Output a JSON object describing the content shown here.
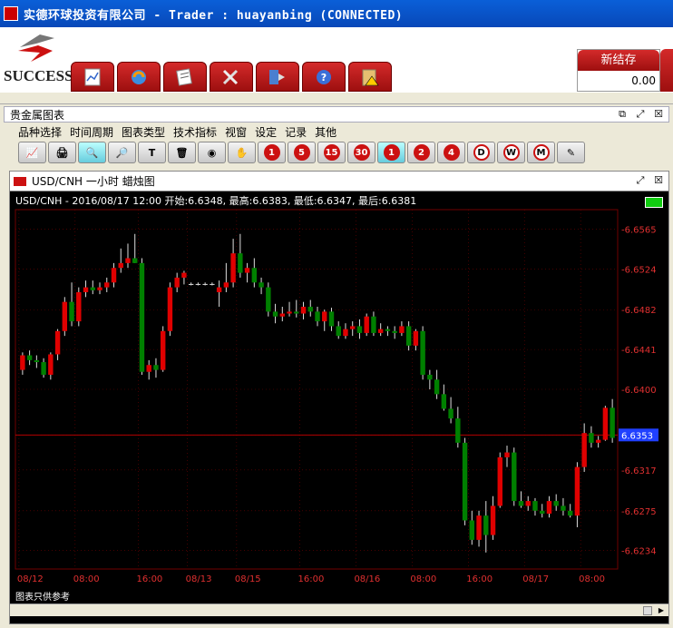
{
  "window": {
    "title": "实德环球投资有限公司 -  Trader : huayanbing (CONNECTED)"
  },
  "brand": {
    "logo_text": "SUCCESS"
  },
  "toolbar": {
    "buttons": [
      {
        "icon": "chart-doc-icon"
      },
      {
        "icon": "refresh-icon"
      },
      {
        "icon": "notes-icon"
      },
      {
        "icon": "tools-icon"
      },
      {
        "icon": "export-icon"
      },
      {
        "icon": "help-icon"
      },
      {
        "icon": "alert-clipboard-icon"
      }
    ]
  },
  "balance": {
    "label": "新结存",
    "value": "0.00"
  },
  "panel": {
    "title": "贵金属图表",
    "menu": [
      "品种选择",
      "时间周期",
      "图表类型",
      "技术指标",
      "视窗",
      "设定",
      "记录",
      "其他"
    ],
    "icon_buttons": [
      {
        "label": "",
        "name": "line-chart-icon"
      },
      {
        "label": "",
        "name": "print-icon"
      },
      {
        "label": "",
        "name": "zoom-in-icon",
        "selected": true
      },
      {
        "label": "",
        "name": "zoom-out-icon"
      },
      {
        "label": "T",
        "name": "text-tool-icon"
      },
      {
        "label": "",
        "name": "delete-icon"
      },
      {
        "label": "",
        "name": "record-icon"
      },
      {
        "label": "",
        "name": "hand-icon"
      },
      {
        "label": "1",
        "name": "period-1m-icon"
      },
      {
        "label": "5",
        "name": "period-5m-icon"
      },
      {
        "label": "15",
        "name": "period-15m-icon"
      },
      {
        "label": "30",
        "name": "period-30m-icon"
      },
      {
        "label": "1",
        "name": "period-1h-icon",
        "selected": true
      },
      {
        "label": "2",
        "name": "period-2h-icon"
      },
      {
        "label": "4",
        "name": "period-4h-icon"
      },
      {
        "label": "D",
        "name": "period-day-icon"
      },
      {
        "label": "W",
        "name": "period-week-icon"
      },
      {
        "label": "M",
        "name": "period-month-icon"
      },
      {
        "label": "",
        "name": "pen-icon"
      }
    ]
  },
  "chart_window": {
    "title": "USD/CNH 一小时 蜡烛图",
    "info": "USD/CNH - 2016/08/17 12:00 开始:6.6348, 最高:6.6383, 最低:6.6347, 最后:6.6381",
    "footnote": "图表只供参考"
  },
  "chart_data": {
    "type": "candlestick",
    "ylim": [
      6.6215,
      6.6585
    ],
    "y_ticks": [
      "6.6565",
      "6.6524",
      "6.6482",
      "6.6441",
      "6.6400",
      "6.6353",
      "6.6317",
      "6.6275",
      "6.6234"
    ],
    "current_price": "6.6353",
    "x_labels": [
      "08/12",
      "08:00",
      "16:00",
      "08/13",
      "08/15",
      "16:00",
      "08/16",
      "08:00",
      "16:00",
      "08/17",
      "08:00"
    ],
    "colors": {
      "up": "#e00000",
      "down": "#008000",
      "grid": "#700000",
      "axis_text": "#e03030"
    },
    "candles": [
      [
        6.642,
        6.6438,
        6.6415,
        6.6435
      ],
      [
        6.6435,
        6.644,
        6.6425,
        6.643
      ],
      [
        6.643,
        6.6435,
        6.6422,
        6.6428
      ],
      [
        6.6428,
        6.6432,
        6.6412,
        6.6415
      ],
      [
        6.6415,
        6.6438,
        6.641,
        6.6436
      ],
      [
        6.6436,
        6.6462,
        6.643,
        6.646
      ],
      [
        6.646,
        6.6495,
        6.6455,
        6.649
      ],
      [
        6.649,
        6.651,
        6.6465,
        6.647
      ],
      [
        6.647,
        6.6505,
        6.6465,
        6.65
      ],
      [
        6.65,
        6.6512,
        6.6495,
        6.6505
      ],
      [
        6.6505,
        6.6512,
        6.6498,
        6.6502
      ],
      [
        6.6502,
        6.651,
        6.6498,
        6.6505
      ],
      [
        6.6505,
        6.6515,
        6.65,
        6.651
      ],
      [
        6.651,
        6.653,
        6.6505,
        6.6525
      ],
      [
        6.6525,
        6.6545,
        6.652,
        6.653
      ],
      [
        6.653,
        6.655,
        6.6525,
        6.6535
      ],
      [
        6.6535,
        6.656,
        6.653,
        6.653
      ],
      [
        6.653,
        6.6535,
        6.6415,
        6.6418
      ],
      [
        6.6418,
        6.643,
        6.641,
        6.6425
      ],
      [
        6.6425,
        6.6432,
        6.6412,
        6.642
      ],
      [
        6.642,
        6.6465,
        6.6418,
        6.646
      ],
      [
        6.646,
        6.651,
        6.6455,
        6.6505
      ],
      [
        6.6505,
        6.652,
        6.65,
        6.6515
      ],
      [
        6.6515,
        6.6522,
        6.6508,
        6.652
      ],
      [
        6.6508,
        6.651,
        6.6507,
        6.6508
      ],
      [
        6.6508,
        6.651,
        6.6507,
        6.6508
      ],
      [
        6.6508,
        6.651,
        6.6507,
        6.6508
      ],
      [
        6.6508,
        6.651,
        6.6507,
        6.6508
      ],
      [
        6.65,
        6.6512,
        6.6485,
        6.6505
      ],
      [
        6.6505,
        6.653,
        6.65,
        6.651
      ],
      [
        6.651,
        6.6555,
        6.6505,
        6.654
      ],
      [
        6.654,
        6.656,
        6.6515,
        6.652
      ],
      [
        6.652,
        6.653,
        6.651,
        6.6525
      ],
      [
        6.6525,
        6.6535,
        6.6505,
        6.651
      ],
      [
        6.651,
        6.6515,
        6.6498,
        6.6505
      ],
      [
        6.6505,
        6.651,
        6.6475,
        6.648
      ],
      [
        6.648,
        6.6488,
        6.6468,
        6.6475
      ],
      [
        6.6475,
        6.6485,
        6.647,
        6.6478
      ],
      [
        6.6478,
        6.649,
        6.6475,
        6.648
      ],
      [
        6.648,
        6.6492,
        6.6474,
        6.6478
      ],
      [
        6.6478,
        6.649,
        6.6472,
        6.6485
      ],
      [
        6.6485,
        6.6492,
        6.6475,
        6.648
      ],
      [
        6.648,
        6.6485,
        6.6465,
        6.647
      ],
      [
        6.647,
        6.6482,
        6.646,
        6.648
      ],
      [
        6.648,
        6.6484,
        6.646,
        6.6465
      ],
      [
        6.6465,
        6.647,
        6.6452,
        6.6455
      ],
      [
        6.6455,
        6.6468,
        6.6452,
        6.6462
      ],
      [
        6.6462,
        6.647,
        6.6455,
        6.6465
      ],
      [
        6.6465,
        6.6472,
        6.6452,
        6.6458
      ],
      [
        6.6458,
        6.6478,
        6.6455,
        6.6475
      ],
      [
        6.6475,
        6.648,
        6.6455,
        6.6458
      ],
      [
        6.6458,
        6.6468,
        6.6455,
        6.6462
      ],
      [
        6.6462,
        6.6465,
        6.6455,
        6.646
      ],
      [
        6.646,
        6.6465,
        6.6452,
        6.6458
      ],
      [
        6.6458,
        6.647,
        6.6455,
        6.6465
      ],
      [
        6.6465,
        6.647,
        6.644,
        6.6445
      ],
      [
        6.6445,
        6.6462,
        6.644,
        6.646
      ],
      [
        6.646,
        6.6465,
        6.641,
        6.6415
      ],
      [
        6.6415,
        6.642,
        6.64,
        6.641
      ],
      [
        6.641,
        6.642,
        6.639,
        6.6395
      ],
      [
        6.6395,
        6.6405,
        6.6378,
        6.638
      ],
      [
        6.638,
        6.6392,
        6.6365,
        6.637
      ],
      [
        6.637,
        6.6382,
        6.634,
        6.6345
      ],
      [
        6.6345,
        6.635,
        6.626,
        6.6265
      ],
      [
        6.6265,
        6.6275,
        6.624,
        6.6245
      ],
      [
        6.6245,
        6.6275,
        6.6238,
        6.627
      ],
      [
        6.627,
        6.6285,
        6.6232,
        6.625
      ],
      [
        6.625,
        6.629,
        6.6245,
        6.628
      ],
      [
        6.628,
        6.6335,
        6.6278,
        6.633
      ],
      [
        6.633,
        6.6342,
        6.632,
        6.6335
      ],
      [
        6.6335,
        6.634,
        6.628,
        6.6285
      ],
      [
        6.6285,
        6.6295,
        6.6278,
        6.628
      ],
      [
        6.628,
        6.629,
        6.6275,
        6.6285
      ],
      [
        6.6285,
        6.6288,
        6.627,
        6.6275
      ],
      [
        6.6275,
        6.6282,
        6.6268,
        6.6272
      ],
      [
        6.6272,
        6.629,
        6.6268,
        6.6285
      ],
      [
        6.6285,
        6.6292,
        6.6275,
        6.628
      ],
      [
        6.628,
        6.6288,
        6.627,
        6.6275
      ],
      [
        6.6275,
        6.6282,
        6.6268,
        6.627
      ],
      [
        6.627,
        6.6325,
        6.6258,
        6.632
      ],
      [
        6.632,
        6.6365,
        6.6315,
        6.6355
      ],
      [
        6.6355,
        6.6362,
        6.634,
        6.6345
      ],
      [
        6.6345,
        6.6352,
        6.634,
        6.6348
      ],
      [
        6.6348,
        6.6383,
        6.6347,
        6.6381
      ],
      [
        6.6381,
        6.639,
        6.6345,
        6.635
      ]
    ]
  }
}
